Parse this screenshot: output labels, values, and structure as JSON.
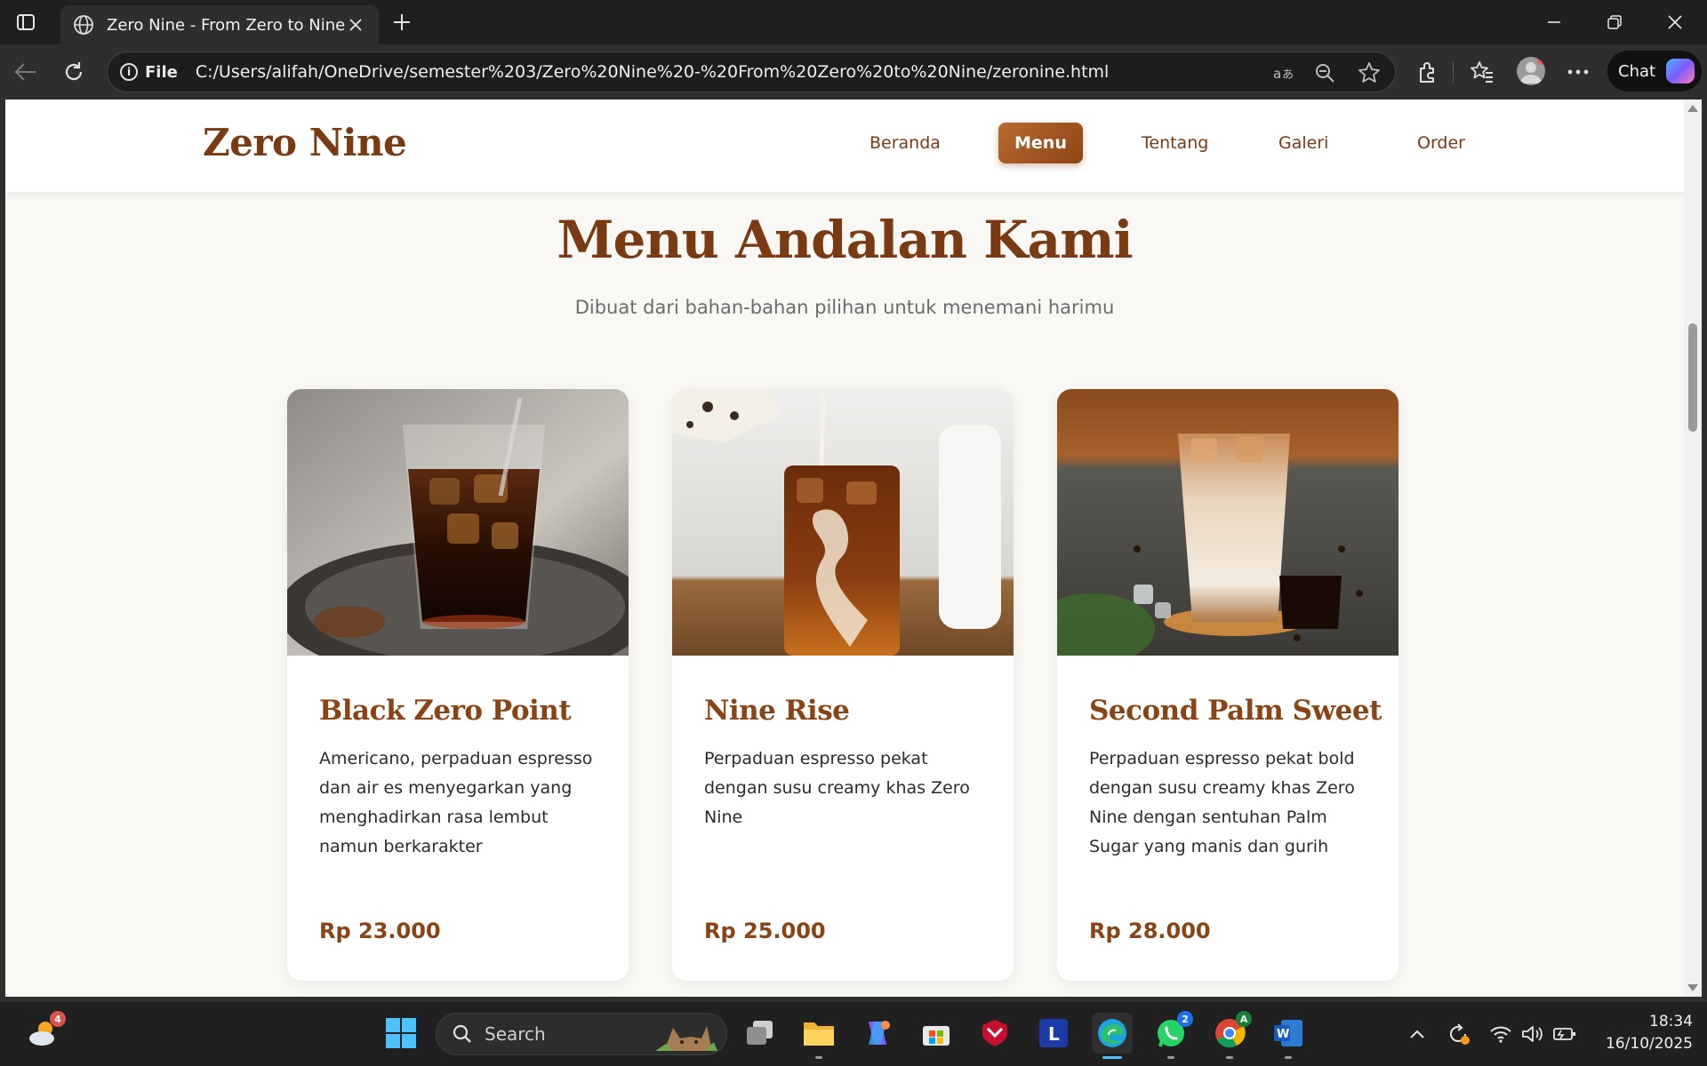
{
  "browser": {
    "tab_title": "Zero Nine - From Zero to Nine",
    "url_scheme_label": "File",
    "url": "C:/Users/alifah/OneDrive/semester%203/Zero%20Nine%20-%20From%20Zero%20to%20Nine/zeronine.html",
    "chat_label": "Chat"
  },
  "site": {
    "brand": "Zero Nine",
    "nav": [
      {
        "label": "Beranda",
        "active": false
      },
      {
        "label": "Menu",
        "active": true
      },
      {
        "label": "Tentang",
        "active": false
      },
      {
        "label": "Galeri",
        "active": false
      },
      {
        "label": "Order",
        "active": false
      }
    ],
    "section_title": "Menu Andalan Kami",
    "section_subtitle": "Dibuat dari bahan-bahan pilihan untuk menemani harimu",
    "items": [
      {
        "name": "Black Zero Point",
        "description": "Americano, perpaduan espresso dan air es menyegarkan yang menghadirkan rasa lembut namun berkarakter",
        "price": "Rp 23.000"
      },
      {
        "name": "Nine Rise",
        "description": "Perpaduan espresso pekat dengan susu creamy khas Zero Nine",
        "price": "Rp 25.000"
      },
      {
        "name": "Second Palm Sweet",
        "description": "Perpaduan espresso pekat bold dengan susu creamy khas Zero Nine dengan sentuhan Palm Sugar yang manis dan gurih",
        "price": "Rp 28.000"
      }
    ]
  },
  "taskbar": {
    "weather_badge": "4",
    "search_placeholder": "Search",
    "whatsapp_badge": "2",
    "chrome_badge": "A",
    "time": "18:34",
    "date": "16/10/2025"
  },
  "colors": {
    "brand_brown": "#7a3a12",
    "accent_gradient_start": "#b86a30",
    "accent_gradient_end": "#8c4515",
    "page_background": "#faf8f5"
  }
}
